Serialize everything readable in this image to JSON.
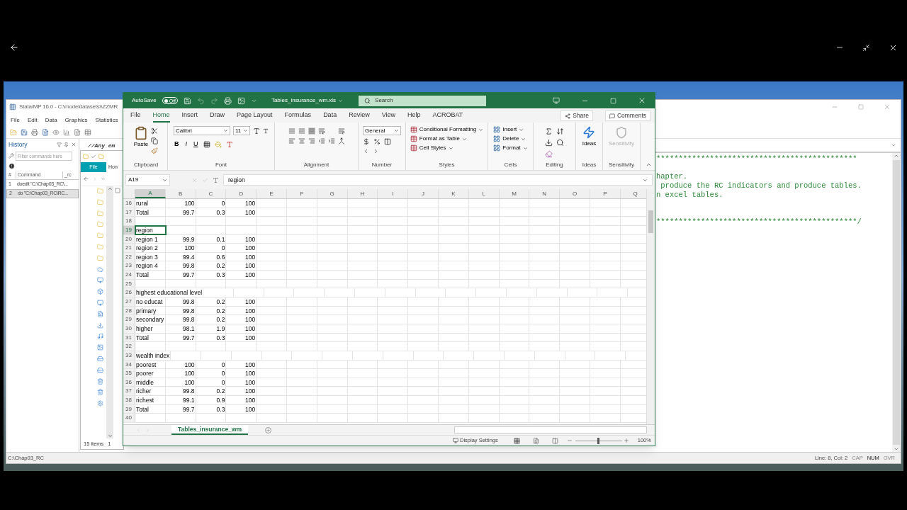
{
  "stata": {
    "title": "Stata/MP 16.0 - C:\\modeldatasets\\\\ZZMR",
    "menu": [
      "File",
      "Edit",
      "Data",
      "Graphics",
      "Statistics"
    ],
    "history": {
      "title": "History",
      "filter_placeholder": "Filter commands here",
      "columns": [
        "#",
        "Command",
        "_rc"
      ],
      "rows": [
        {
          "num": "1",
          "command": "doedit \"C:\\Chap03_RC\\...",
          "selected": false
        },
        {
          "num": "2",
          "command": "do \"C:\\Chap03_RC\\RC...",
          "selected": true
        }
      ]
    },
    "editor_tab": "//Any em",
    "editor_lines": [
      {
        "kind": "code",
        "text": "*********************************************"
      },
      {
        "kind": "blank"
      },
      {
        "kind": "code",
        "text": "hapter."
      },
      {
        "kind": "code",
        "text": " produce the RC indicators and produce tables."
      },
      {
        "kind": "code",
        "text": "n excel tables."
      },
      {
        "kind": "blank"
      },
      {
        "kind": "blank"
      },
      {
        "kind": "code",
        "text": "*********************************************/"
      }
    ],
    "status_path": "C:\\Chap03_RC",
    "position": "Line: 8, Col: 2",
    "indicators": [
      {
        "label": "CAP",
        "on": false
      },
      {
        "label": "NUM",
        "on": true
      },
      {
        "label": "OVR",
        "on": false
      }
    ]
  },
  "explorer": {
    "tabs": [
      "File",
      "Hon"
    ],
    "status": "15 items",
    "status_2": "1"
  },
  "excel": {
    "autosave": {
      "label": "AutoSave",
      "on": false,
      "state_text": "Off"
    },
    "title": "Tables_insurance_wm.xls",
    "search": "Search",
    "tabs": [
      {
        "label": "File",
        "selected": false
      },
      {
        "label": "Home",
        "selected": true
      },
      {
        "label": "Insert",
        "selected": false
      },
      {
        "label": "Draw",
        "selected": false
      },
      {
        "label": "Page Layout",
        "selected": false
      },
      {
        "label": "Formulas",
        "selected": false
      },
      {
        "label": "Data",
        "selected": false
      },
      {
        "label": "Review",
        "selected": false
      },
      {
        "label": "View",
        "selected": false
      },
      {
        "label": "Help",
        "selected": false
      },
      {
        "label": "ACROBAT",
        "selected": false
      }
    ],
    "share": "Share",
    "comments": "Comments",
    "groups": [
      {
        "kind": "clipboard",
        "label": "Clipboard",
        "button": "Paste"
      },
      {
        "kind": "font",
        "label": "Font",
        "font": "Calibri",
        "size": "11",
        "bold": "B",
        "italic": "I",
        "underline": "U"
      },
      {
        "kind": "alignment",
        "label": "Alignment"
      },
      {
        "kind": "number",
        "label": "Number",
        "format": "General"
      },
      {
        "kind": "styles",
        "label": "Styles",
        "items": [
          "Conditional Formatting",
          "Format as Table",
          "Cell Styles"
        ]
      },
      {
        "kind": "cells",
        "label": "Cells",
        "items": [
          "Insert",
          "Delete",
          "Format"
        ]
      },
      {
        "kind": "editing",
        "label": "Editing"
      },
      {
        "kind": "ideas",
        "label": "Ideas",
        "button": "Ideas"
      },
      {
        "kind": "sensitivity",
        "label": "Sensitivity",
        "button": "Sensitivity",
        "disabled": true
      }
    ],
    "name_box": "A19",
    "formula": "region",
    "columns": [
      {
        "label": "A",
        "selected": true
      },
      {
        "label": "B",
        "selected": false
      },
      {
        "label": "C",
        "selected": false
      },
      {
        "label": "D",
        "selected": false
      },
      {
        "label": "E",
        "selected": false
      },
      {
        "label": "F",
        "selected": false
      },
      {
        "label": "G",
        "selected": false
      },
      {
        "label": "H",
        "selected": false
      },
      {
        "label": "I",
        "selected": false
      },
      {
        "label": "J",
        "selected": false
      },
      {
        "label": "K",
        "selected": false
      },
      {
        "label": "L",
        "selected": false
      },
      {
        "label": "M",
        "selected": false
      },
      {
        "label": "N",
        "selected": false
      },
      {
        "label": "O",
        "selected": false
      },
      {
        "label": "P",
        "selected": false
      },
      {
        "label": "Q",
        "selected": false
      }
    ],
    "rows": [
      {
        "num": "16",
        "cells": [
          "rural",
          "100",
          "0",
          "100"
        ],
        "selected": false
      },
      {
        "num": "17",
        "cells": [
          "Total",
          "99.7",
          "0.3",
          "100"
        ],
        "selected": false
      },
      {
        "num": "18",
        "selected": false
      },
      {
        "num": "19",
        "cells": [
          "region"
        ],
        "selected": true
      },
      {
        "num": "20",
        "cells": [
          "region 1",
          "99.9",
          "0.1",
          "100"
        ],
        "selected": false
      },
      {
        "num": "21",
        "cells": [
          "region 2",
          "100",
          "0",
          "100"
        ],
        "selected": false
      },
      {
        "num": "22",
        "cells": [
          "region 3",
          "99.4",
          "0.6",
          "100"
        ],
        "selected": false
      },
      {
        "num": "23",
        "cells": [
          "region 4",
          "99.8",
          "0.2",
          "100"
        ],
        "selected": false
      },
      {
        "num": "24",
        "cells": [
          "Total",
          "99.7",
          "0.3",
          "100"
        ],
        "selected": false
      },
      {
        "num": "25",
        "selected": false
      },
      {
        "num": "26",
        "cells": [
          "highest educational level"
        ],
        "selected": false
      },
      {
        "num": "27",
        "cells": [
          "no educat",
          "99.8",
          "0.2",
          "100"
        ],
        "selected": false
      },
      {
        "num": "28",
        "cells": [
          "primary",
          "99.8",
          "0.2",
          "100"
        ],
        "selected": false
      },
      {
        "num": "29",
        "cells": [
          "secondary",
          "99.8",
          "0.2",
          "100"
        ],
        "selected": false
      },
      {
        "num": "30",
        "cells": [
          "higher",
          "98.1",
          "1.9",
          "100"
        ],
        "selected": false
      },
      {
        "num": "31",
        "cells": [
          "Total",
          "99.7",
          "0.3",
          "100"
        ],
        "selected": false
      },
      {
        "num": "32",
        "selected": false
      },
      {
        "num": "33",
        "cells": [
          "wealth index"
        ],
        "selected": false
      },
      {
        "num": "34",
        "cells": [
          "poorest",
          "100",
          "0",
          "100"
        ],
        "selected": false
      },
      {
        "num": "35",
        "cells": [
          "poorer",
          "100",
          "0",
          "100"
        ],
        "selected": false
      },
      {
        "num": "36",
        "cells": [
          "middle",
          "100",
          "0",
          "100"
        ],
        "selected": false
      },
      {
        "num": "37",
        "cells": [
          "richer",
          "99.8",
          "0.2",
          "100"
        ],
        "selected": false
      },
      {
        "num": "38",
        "cells": [
          "richest",
          "99.1",
          "0.9",
          "100"
        ],
        "selected": false
      },
      {
        "num": "39",
        "cells": [
          "Total",
          "99.7",
          "0.3",
          "100"
        ],
        "selected": false
      },
      {
        "num": "40",
        "selected": false
      }
    ],
    "sheet_tab": "Tables_insurance_wm",
    "display_settings": "Display Settings",
    "zoom": {
      "level": 0.5,
      "label": "100%"
    }
  }
}
